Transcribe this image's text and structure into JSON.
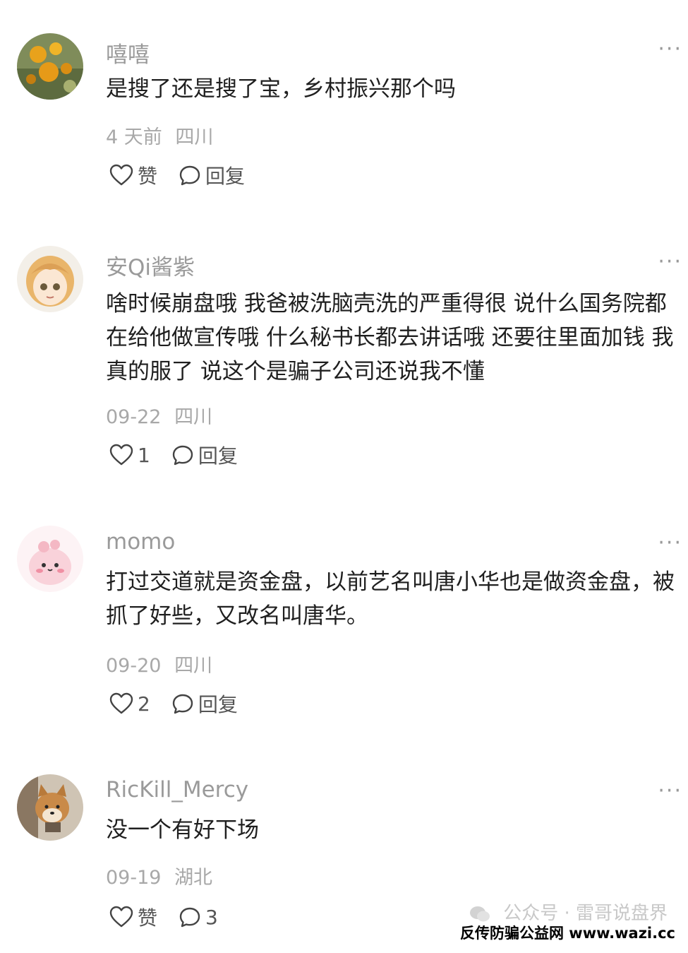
{
  "comments": [
    {
      "username": "嘻嘻",
      "content": "是搜了还是搜了宝，乡村振兴那个吗",
      "time": "4 天前",
      "location": "四川",
      "like_label": "赞",
      "reply_label": "回复",
      "avatar": "flower-photo-avatar",
      "more_label": "···"
    },
    {
      "username": "安Qi酱紫",
      "content": "啥时候崩盘哦 我爸被洗脑壳洗的严重得很 说什么国务院都在给他做宣传哦 什么秘书长都去讲话哦 还要往里面加钱 我真的服了 说这个是骗子公司还说我不懂",
      "time": "09-22",
      "location": "四川",
      "like_label": "1",
      "reply_label": "回复",
      "avatar": "anime-girl-avatar",
      "more_label": "···"
    },
    {
      "username": "momo",
      "content": "打过交道就是资金盘，以前艺名叫唐小华也是做资金盘，被抓了好些，又改名叫唐华。",
      "time": "09-20",
      "location": "四川",
      "like_label": "2",
      "reply_label": "回复",
      "avatar": "pink-cartoon-avatar",
      "more_label": "···"
    },
    {
      "username": "RicKill_Mercy",
      "content": "没一个有好下场",
      "time": "09-19",
      "location": "湖北",
      "like_label": "赞",
      "reply_label": "3",
      "avatar": "shiba-dog-avatar",
      "more_label": "···"
    }
  ],
  "watermark": {
    "text": "公众号 · 雷哥说盘界"
  },
  "footer": {
    "brand": "反传防骗公益网 www.wazi.cc"
  },
  "colors": {
    "username": "#9a9a9a",
    "content": "#1f1f1f",
    "meta": "#a8a8a8",
    "action": "#555555"
  }
}
